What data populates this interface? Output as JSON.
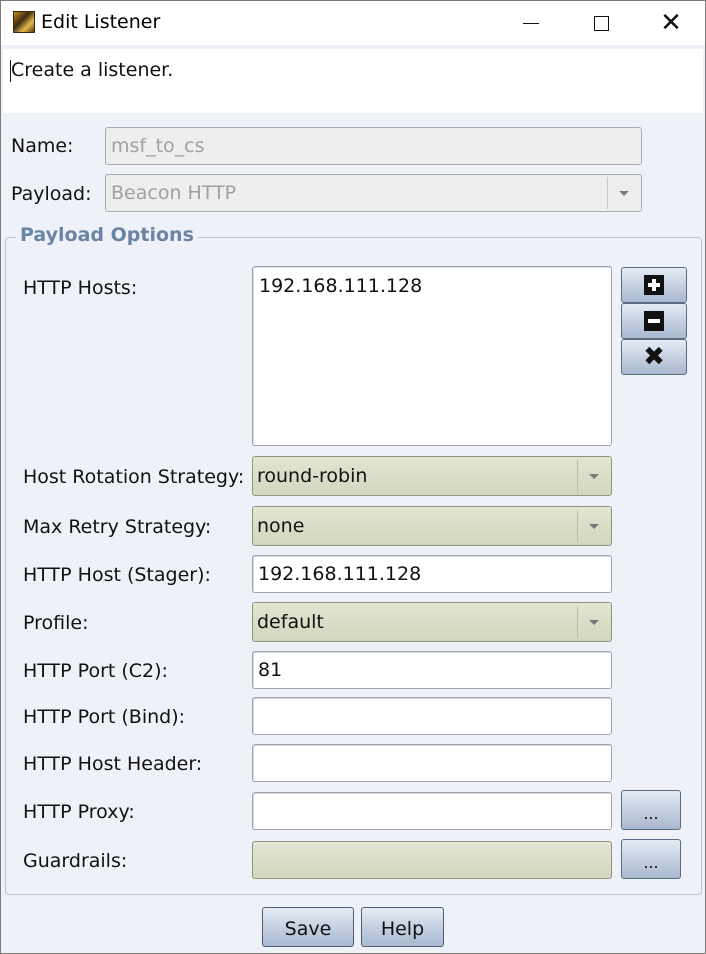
{
  "window": {
    "title": "Edit Listener",
    "minimize_icon": "minimize-icon",
    "maximize_icon": "maximize-icon",
    "close_icon": "close-icon",
    "close_glyph": "✕"
  },
  "description": "Create a listener.",
  "form": {
    "name_label": "Name:",
    "name_value": "msf_to_cs",
    "payload_label": "Payload:",
    "payload_value": "Beacon HTTP"
  },
  "payload_options": {
    "title": "Payload Options",
    "http_hosts_label": "HTTP Hosts:",
    "http_hosts": [
      "192.168.111.128"
    ],
    "host_buttons": [
      "add-icon",
      "remove-icon",
      "clear-icon"
    ],
    "clear_glyph": "✖",
    "host_rotation_label": "Host Rotation Strategy:",
    "host_rotation_value": "round-robin",
    "max_retry_label": "Max Retry Strategy:",
    "max_retry_value": "none",
    "stager_host_label": "HTTP Host (Stager):",
    "stager_host_value": "192.168.111.128",
    "profile_label": "Profile:",
    "profile_value": "default",
    "port_c2_label": "HTTP Port (C2):",
    "port_c2_value": "81",
    "port_bind_label": "HTTP Port (Bind):",
    "port_bind_value": "",
    "host_header_label": "HTTP Host Header:",
    "host_header_value": "",
    "proxy_label": "HTTP Proxy:",
    "proxy_value": "",
    "proxy_button": "...",
    "guardrails_label": "Guardrails:",
    "guardrails_button": "..."
  },
  "buttons": {
    "save": "Save",
    "help": "Help"
  },
  "colors": {
    "group_title": "#6a84a6",
    "select_fill": "#d8dcc6",
    "button_fill": "#c5d1e2"
  }
}
